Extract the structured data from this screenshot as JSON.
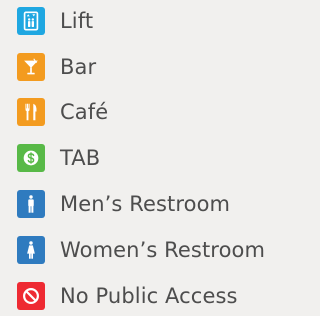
{
  "legend": {
    "items": [
      {
        "label": "Lift",
        "icon": "lift-icon",
        "color": "#1fa7e1"
      },
      {
        "label": "Bar",
        "icon": "cocktail-glass-icon",
        "color": "#f39b1f"
      },
      {
        "label": "Café",
        "icon": "fork-knife-icon",
        "color": "#f39b1f"
      },
      {
        "label": "TAB",
        "icon": "dollar-coin-icon",
        "color": "#58b947"
      },
      {
        "label": "Men’s Restroom",
        "icon": "man-icon",
        "color": "#2f7bbf"
      },
      {
        "label": "Women’s Restroom",
        "icon": "woman-icon",
        "color": "#2f7bbf"
      },
      {
        "label": "No Public Access",
        "icon": "no-entry-icon",
        "color": "#ee2a32"
      }
    ]
  }
}
